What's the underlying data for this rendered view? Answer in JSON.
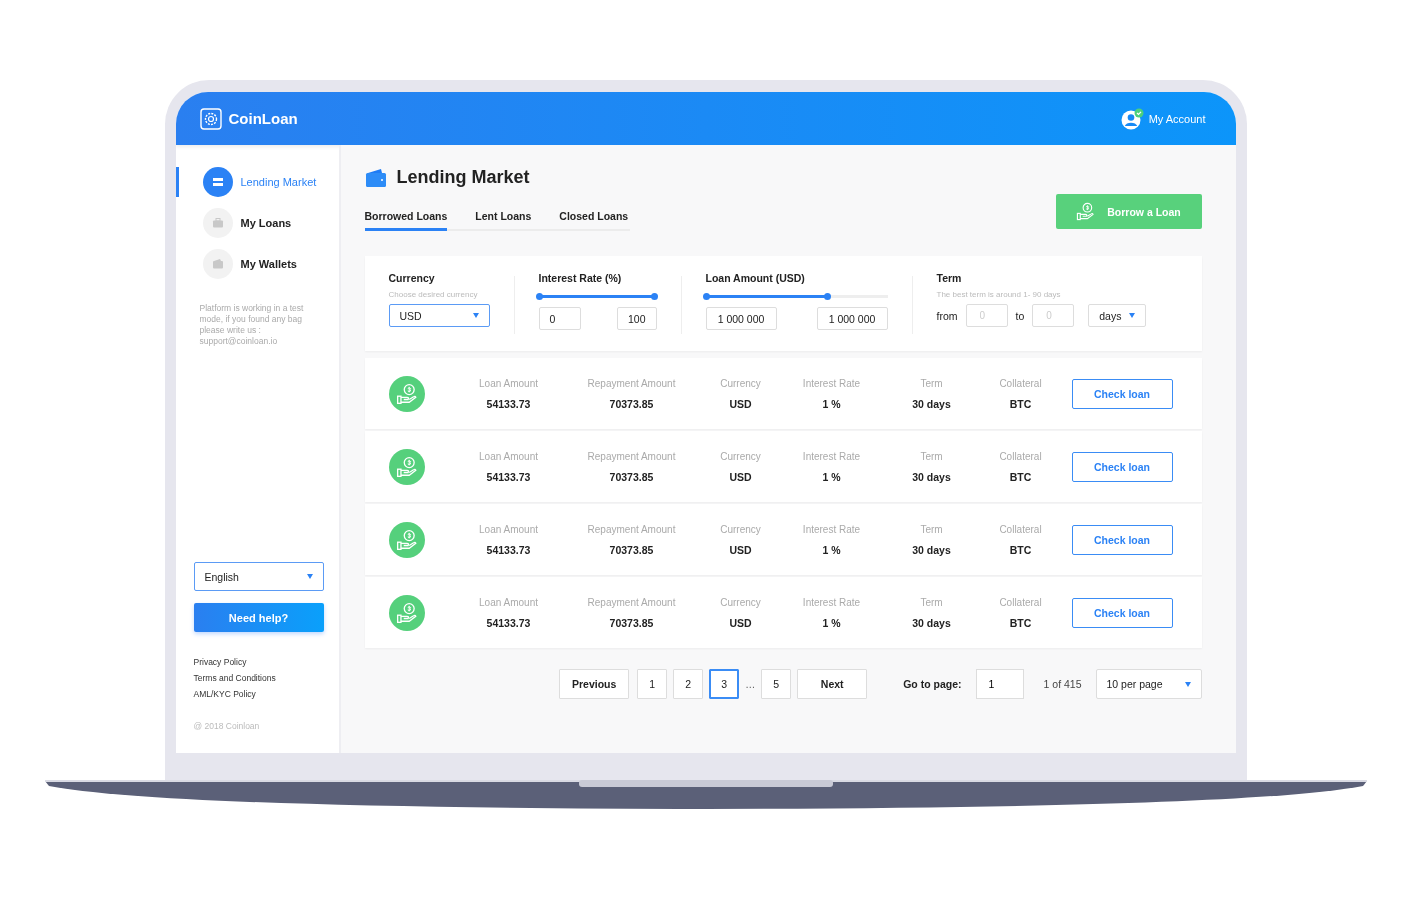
{
  "header": {
    "logo": "CoinLoan",
    "account": "My Account",
    "verified": true
  },
  "sidebar": {
    "items": [
      {
        "label": "Lending Market",
        "selected": true
      },
      {
        "label": "My Loans",
        "selected": false
      },
      {
        "label": "My Wallets",
        "selected": false
      }
    ],
    "note": "Platform is working in a test mode, if you found any bag please write us : support@coinloan.io",
    "language": "English",
    "help": "Need help?",
    "links": [
      "Privacy Policy",
      "Terms and Conditions",
      "AML/KYC Policy"
    ],
    "copyright": "@ 2018 Coinloan"
  },
  "page": {
    "title": "Lending Market",
    "tabs": [
      {
        "label": "Borrowed Loans",
        "selected": true
      },
      {
        "label": "Lent Loans",
        "selected": false
      },
      {
        "label": "Closed Loans",
        "selected": false
      }
    ],
    "borrow_button": "Borrow a Loan"
  },
  "filters": {
    "currency": {
      "label": "Currency",
      "hint": "Choose desired currency",
      "value": "USD"
    },
    "interest": {
      "label": "Interest Rate (%)",
      "level": 1,
      "min": "0",
      "max": "100"
    },
    "amount": {
      "label": "Loan Amount (USD)",
      "level": 0.67,
      "min": "1 000 000",
      "max": "1 000 000"
    },
    "term": {
      "label": "Term",
      "hint": "The best term is around 1- 90 days",
      "from": "from",
      "from_placeholder": "0",
      "to": "to",
      "to_placeholder": "0",
      "unit": "days"
    }
  },
  "loans": [
    {
      "fields": [
        {
          "label": "Loan Amount",
          "value": "54133.73"
        },
        {
          "label": "Repayment Amount",
          "value": "70373.85"
        },
        {
          "label": "Currency",
          "value": "USD"
        },
        {
          "label": "Interest Rate",
          "value": "1 %"
        },
        {
          "label": "Term",
          "value": "30 days"
        },
        {
          "label": "Collateral",
          "value": "BTC"
        }
      ],
      "button": "Check loan"
    },
    {
      "fields": [
        {
          "label": "Loan Amount",
          "value": "54133.73"
        },
        {
          "label": "Repayment Amount",
          "value": "70373.85"
        },
        {
          "label": "Currency",
          "value": "USD"
        },
        {
          "label": "Interest Rate",
          "value": "1 %"
        },
        {
          "label": "Term",
          "value": "30 days"
        },
        {
          "label": "Collateral",
          "value": "BTC"
        }
      ],
      "button": "Check loan"
    },
    {
      "fields": [
        {
          "label": "Loan Amount",
          "value": "54133.73"
        },
        {
          "label": "Repayment Amount",
          "value": "70373.85"
        },
        {
          "label": "Currency",
          "value": "USD"
        },
        {
          "label": "Interest Rate",
          "value": "1 %"
        },
        {
          "label": "Term",
          "value": "30 days"
        },
        {
          "label": "Collateral",
          "value": "BTC"
        }
      ],
      "button": "Check loan"
    },
    {
      "fields": [
        {
          "label": "Loan Amount",
          "value": "54133.73"
        },
        {
          "label": "Repayment Amount",
          "value": "70373.85"
        },
        {
          "label": "Currency",
          "value": "USD"
        },
        {
          "label": "Interest Rate",
          "value": "1 %"
        },
        {
          "label": "Term",
          "value": "30 days"
        },
        {
          "label": "Collateral",
          "value": "BTC"
        }
      ],
      "button": "Check loan"
    }
  ],
  "pagination": {
    "previous": "Previous",
    "pages": [
      {
        "label": "1",
        "selected": false
      },
      {
        "label": "2",
        "selected": false
      },
      {
        "label": "3",
        "selected": true
      },
      {
        "label": "…",
        "kind": "gap"
      },
      {
        "label": "5",
        "selected": false
      }
    ],
    "next": "Next",
    "goto_label": "Go to page:",
    "goto_value": "1",
    "count": "1 of 415",
    "per_page": "10 per page"
  }
}
